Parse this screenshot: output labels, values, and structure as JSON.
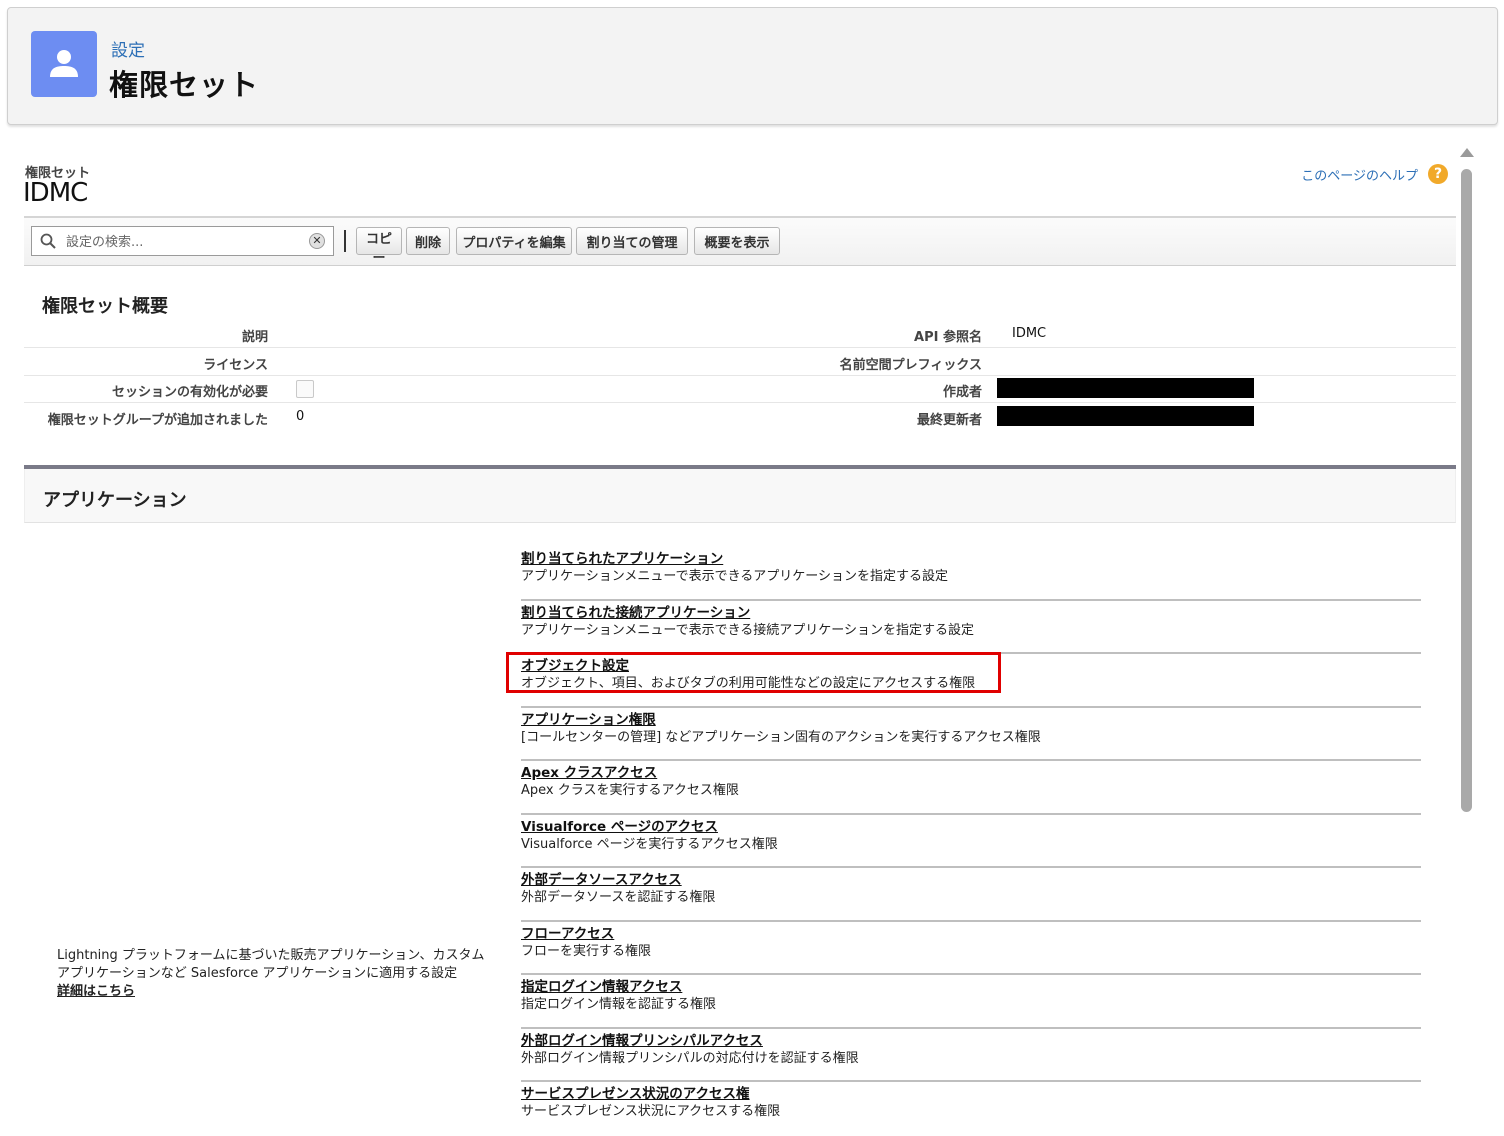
{
  "header": {
    "breadcrumb": "設定",
    "title": "権限セット",
    "icon": "user-icon",
    "icon_color": "#6d8df2"
  },
  "page": {
    "type_label": "権限セット",
    "name": "IDMC",
    "help_label": "このページのヘルプ"
  },
  "search": {
    "placeholder": "設定の検索..."
  },
  "toolbar": {
    "buttons": [
      "コピー",
      "削除",
      "プロパティを編集",
      "割り当ての管理",
      "概要を表示"
    ]
  },
  "overview": {
    "title": "権限セット概要",
    "rows": [
      {
        "left_label": "説明",
        "left_value": "",
        "right_label": "API 参照名",
        "right_value": "IDMC"
      },
      {
        "left_label": "ライセンス",
        "left_value": "",
        "right_label": "名前空間プレフィックス",
        "right_value": ""
      },
      {
        "left_label": "セッションの有効化が必要",
        "left_value": "",
        "right_label": "作成者",
        "right_value": "[redacted]"
      },
      {
        "left_label": "権限セットグループが追加されました",
        "left_value": "0",
        "right_label": "最終更新者",
        "right_value": "[redacted]"
      }
    ]
  },
  "applications": {
    "title": "アプリケーション",
    "description": "Lightning プラットフォームに基づいた販売アプリケーション、カスタムアプリケーションなど Salesforce アプリケーションに適用する設定",
    "more_link": "詳細はこちら",
    "items": [
      {
        "title": "割り当てられたアプリケーション",
        "desc": "アプリケーションメニューで表示できるアプリケーションを指定する設定"
      },
      {
        "title": "割り当てられた接続アプリケーション",
        "desc": "アプリケーションメニューで表示できる接続アプリケーションを指定する設定"
      },
      {
        "title": "オブジェクト設定",
        "desc": "オブジェクト、項目、およびタブの利用可能性などの設定にアクセスする権限"
      },
      {
        "title": "アプリケーション権限",
        "desc": "[コールセンターの管理] などアプリケーション固有のアクションを実行するアクセス権限"
      },
      {
        "title": "Apex クラスアクセス",
        "desc": "Apex クラスを実行するアクセス権限"
      },
      {
        "title": "Visualforce ページのアクセス",
        "desc": "Visualforce ページを実行するアクセス権限"
      },
      {
        "title": "外部データソースアクセス",
        "desc": "外部データソースを認証する権限"
      },
      {
        "title": "フローアクセス",
        "desc": "フローを実行する権限"
      },
      {
        "title": "指定ログイン情報アクセス",
        "desc": "指定ログイン情報を認証する権限"
      },
      {
        "title": "外部ログイン情報プリンシパルアクセス",
        "desc": "外部ログイン情報プリンシパルの対応付けを認証する権限"
      },
      {
        "title": "サービスプレゼンス状況のアクセス権",
        "desc": "サービスプレゼンス状況にアクセスする権限"
      }
    ],
    "highlight_color": "#e00000"
  }
}
